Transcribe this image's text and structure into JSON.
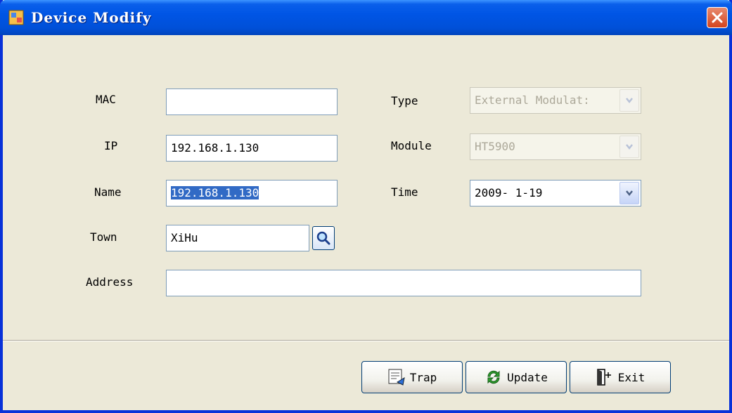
{
  "window": {
    "title": "Device Modify",
    "close_symbol": "✕"
  },
  "form": {
    "mac": {
      "label": "MAC",
      "value": ""
    },
    "ip": {
      "label": "IP",
      "value": "192.168.1.130"
    },
    "name": {
      "label": "Name",
      "value": "192.168.1.130"
    },
    "town": {
      "label": "Town",
      "value": "XiHu"
    },
    "address": {
      "label": "Address",
      "value": ""
    },
    "type": {
      "label": "Type",
      "value": "External Modulat:"
    },
    "module": {
      "label": "Module",
      "value": "HT5900"
    },
    "time": {
      "label": "Time",
      "value": "2009- 1-19"
    }
  },
  "buttons": {
    "trap": "Trap",
    "update": "Update",
    "exit": "Exit"
  },
  "icons": {
    "app": "device-app-icon",
    "search": "magnifier-icon",
    "trap": "trap-icon",
    "update": "refresh-icon",
    "exit": "exit-door-icon",
    "dropdown": "chevron-down-icon"
  },
  "colors": {
    "titlebar": "#0055E5",
    "dialog_bg": "#ECE9D8",
    "selection": "#316AC5",
    "close": "#D3431D"
  }
}
